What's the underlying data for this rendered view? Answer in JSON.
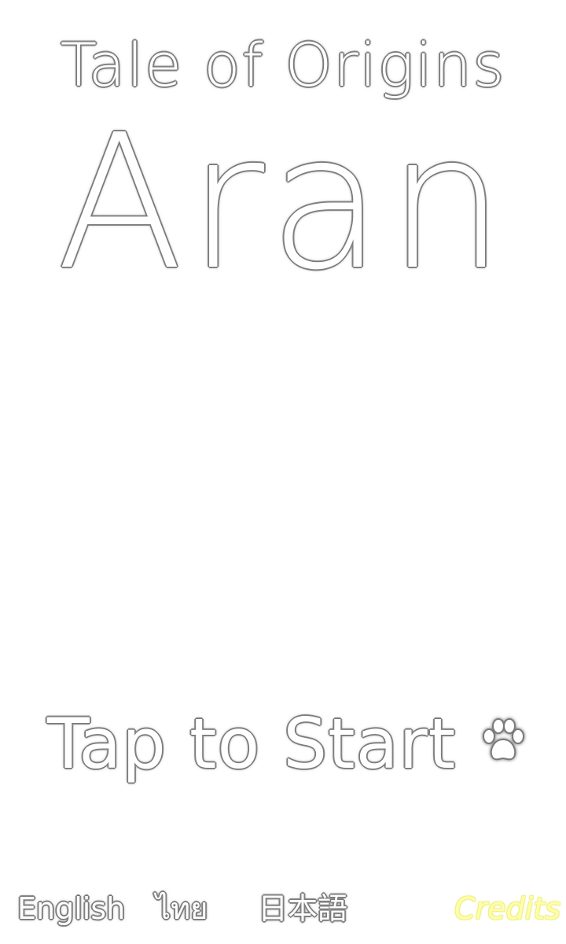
{
  "game": {
    "subtitle": "Tale of Origins",
    "title": "Aran"
  },
  "start": {
    "label": "Tap to Start",
    "icon": "paw-icon"
  },
  "languages": {
    "english": "English",
    "thai": "ไทย",
    "japanese": "日本語"
  },
  "credits": {
    "label": "Credits"
  },
  "colors": {
    "background": "#ffffff",
    "text_fill": "#ffffff",
    "outline": "#7a7a7a",
    "credits": "#ffffa8"
  }
}
